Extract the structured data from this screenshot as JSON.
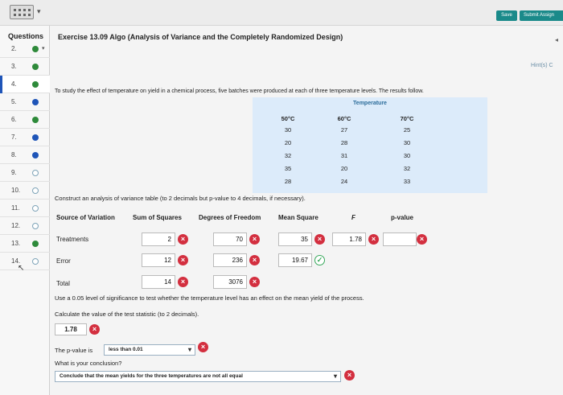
{
  "toolbar": {
    "save": "Save",
    "submit": "Submit Assign"
  },
  "sidebar": {
    "heading": "Questions",
    "items": [
      {
        "num": "2.",
        "status": "check"
      },
      {
        "num": "3.",
        "status": "check"
      },
      {
        "num": "4.",
        "status": "check"
      },
      {
        "num": "5.",
        "status": "full"
      },
      {
        "num": "6.",
        "status": "check"
      },
      {
        "num": "7.",
        "status": "full"
      },
      {
        "num": "8.",
        "status": "full"
      },
      {
        "num": "9.",
        "status": "empty"
      },
      {
        "num": "10.",
        "status": "empty"
      },
      {
        "num": "11.",
        "status": "empty"
      },
      {
        "num": "12.",
        "status": "empty"
      },
      {
        "num": "13.",
        "status": "check"
      },
      {
        "num": "14.",
        "status": "empty"
      }
    ]
  },
  "exercise": {
    "title": "Exercise 13.09 Algo (Analysis of Variance and the Completely Randomized Design)",
    "hint": "Hint(s) C",
    "intro": "To study the effect of temperature on yield in a chemical process, five batches were produced at each of three temperature levels. The results follow."
  },
  "temperature": {
    "title": "Temperature",
    "columns": [
      {
        "header": "50°C",
        "values": [
          "30",
          "20",
          "32",
          "35",
          "28"
        ]
      },
      {
        "header": "60°C",
        "values": [
          "27",
          "28",
          "31",
          "20",
          "24"
        ]
      },
      {
        "header": "70°C",
        "values": [
          "25",
          "30",
          "30",
          "32",
          "33"
        ]
      }
    ]
  },
  "anova": {
    "instruction": "Construct an analysis of variance table (to 2 decimals but p-value to 4 decimals, if necessary).",
    "headers": {
      "source": "Source of Variation",
      "ss": "Sum of Squares",
      "df": "Degrees of Freedom",
      "ms": "Mean Square",
      "f": "F",
      "p": "p-value"
    },
    "rows": {
      "treatments": {
        "label": "Treatments",
        "ss": "2",
        "df": "70",
        "ms": "35",
        "f": "1.78",
        "p": ""
      },
      "error": {
        "label": "Error",
        "ss": "12",
        "df": "236",
        "ms": "19.67"
      },
      "total": {
        "label": "Total",
        "ss": "14",
        "df": "3076"
      }
    }
  },
  "questions": {
    "q1": "Use a 0.05 level of significance to test whether the temperature level has an effect on the mean yield of the process.",
    "q2": "Calculate the value of the test statistic (to 2 decimals).",
    "test_stat": "1.78",
    "pvalue_prefix": "The p-value is",
    "pvalue_select": "less than 0.01",
    "conclusion_q": "What is your conclusion?",
    "conclusion_select": "Conclude that the mean yields for the three temperatures are not all equal"
  }
}
